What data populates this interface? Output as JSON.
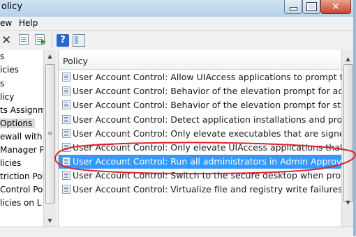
{
  "window": {
    "title": "olicy",
    "buttons": {
      "minimize": "minimize",
      "maximize": "maximize",
      "close": "✕"
    }
  },
  "menu": {
    "items": [
      "ew",
      "Help"
    ]
  },
  "toolbar": {
    "icons": [
      "delete-icon",
      "properties-icon",
      "export-icon",
      "help-icon",
      "view-icon"
    ]
  },
  "tree": {
    "items": [
      {
        "label": "s"
      },
      {
        "label": "icies"
      },
      {
        "label": "s"
      },
      {
        "label": "licy"
      },
      {
        "label": "ts Assignm"
      },
      {
        "label": " Options",
        "selected": true
      },
      {
        "label": "ewall with A"
      },
      {
        "label": " Manager P"
      },
      {
        "label": "licies"
      },
      {
        "label": "triction Pol"
      },
      {
        "label": "Control Pol"
      },
      {
        "label": "licies on L"
      }
    ]
  },
  "policy_list": {
    "header": "Policy",
    "rows": [
      {
        "text": "User Account Control: Allow UIAccess applications to prompt for elevatio"
      },
      {
        "text": "User Account Control: Behavior of the elevation prompt for administrato"
      },
      {
        "text": "User Account Control: Behavior of the elevation prompt for standard use"
      },
      {
        "text": "User Account Control: Detect application installations and prompt for ele"
      },
      {
        "text": "User Account Control: Only elevate executables that are signed and valid"
      },
      {
        "text": "User Account Control: Only elevate UIAccess applications that are installe"
      },
      {
        "text": "User Account Control: Run all administrators in Admin Approval Mode",
        "selected": true
      },
      {
        "text": "User Account Control: Switch to the secure desktop when prompting for"
      },
      {
        "text": "User Account Control: Virtualize file and registry write failures to per-user"
      }
    ]
  },
  "annotation": {
    "color": "#e0202a"
  },
  "colors": {
    "selection": "#3399ff",
    "tree_selected": "#d9d9d9"
  }
}
